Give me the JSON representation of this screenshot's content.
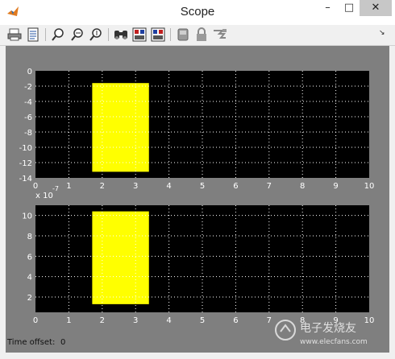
{
  "window": {
    "title": "Scope",
    "icon": "matlab-icon",
    "controls": [
      "minimize-icon",
      "maximize-icon",
      "close-icon"
    ]
  },
  "toolbar": {
    "icons": [
      "print-icon",
      "parameters-icon",
      "zoom-icon",
      "zoom-x-icon",
      "zoom-y-icon",
      "autoscale-icon",
      "save-axes-settings-icon",
      "restore-axes-settings-icon",
      "floating-scope-icon",
      "lock-axes-icon",
      "signal-selector-icon",
      "dock-arrow-icon"
    ]
  },
  "status": {
    "label": "Time offset:",
    "value": "0"
  },
  "colors": {
    "background": "#7f7f7f",
    "axes": "#000000",
    "signal": "#ffff00",
    "grid": "#ffffff",
    "text": "#ffffff"
  },
  "watermark": {
    "text": "电子发烧友",
    "url": "www.elecfans.com"
  },
  "chart_data": [
    {
      "type": "area",
      "x_ticks": [
        "0",
        "1",
        "2",
        "3",
        "4",
        "5",
        "6",
        "7",
        "8",
        "9",
        "10"
      ],
      "y_ticks": [
        "0",
        "-2",
        "-4",
        "-6",
        "-8",
        "-10",
        "-12",
        "-14"
      ],
      "xlim": [
        0,
        10
      ],
      "ylim": [
        -14,
        0
      ],
      "y_multiplier": "x 10",
      "y_exponent": "-7",
      "grid": true,
      "series": [
        {
          "x": [
            1.7,
            3.4
          ],
          "y_min": -13.2,
          "y_max": -1.6,
          "color": "#ffff00"
        }
      ]
    },
    {
      "type": "area",
      "x_ticks": [
        "0",
        "1",
        "2",
        "3",
        "4",
        "5",
        "6",
        "7",
        "8",
        "9",
        "10"
      ],
      "y_ticks": [
        "10",
        "8",
        "6",
        "4",
        "2"
      ],
      "xlim": [
        0,
        10
      ],
      "ylim": [
        0.5,
        11
      ],
      "grid": true,
      "series": [
        {
          "x": [
            1.7,
            3.4
          ],
          "y_min": 1.3,
          "y_max": 10.4,
          "color": "#ffff00"
        }
      ]
    }
  ]
}
